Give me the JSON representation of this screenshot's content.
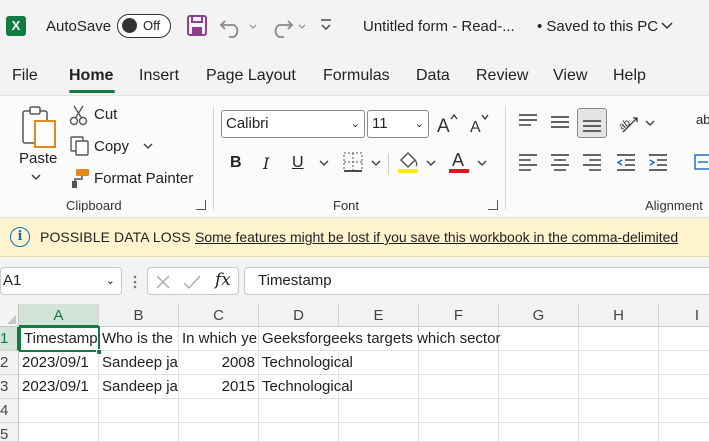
{
  "titlebar": {
    "app_letter": "X",
    "autosave_label": "AutoSave",
    "autosave_state": "Off",
    "title": "Untitled form  -  Read-...",
    "save_status": "• Saved to this PC"
  },
  "tabs": [
    "File",
    "Home",
    "Insert",
    "Page Layout",
    "Formulas",
    "Data",
    "Review",
    "View",
    "Help"
  ],
  "active_tab": "Home",
  "ribbon": {
    "clipboard": {
      "paste": "Paste",
      "cut": "Cut",
      "copy": "Copy",
      "format_painter": "Format Painter",
      "group_label": "Clipboard"
    },
    "font": {
      "font_name": "Calibri",
      "font_size": "11",
      "bold": "B",
      "italic": "I",
      "underline": "U",
      "group_label": "Font"
    },
    "alignment": {
      "group_label": "Alignment",
      "wrap_partial": "ab"
    }
  },
  "message_bar": {
    "title": "POSSIBLE DATA LOSS",
    "text": "Some features might be lost if you save this workbook in the comma-delimited"
  },
  "formula_bar": {
    "name_box": "A1",
    "fx": "fx",
    "value": "Timestamp"
  },
  "grid": {
    "columns": [
      "A",
      "B",
      "C",
      "D",
      "E",
      "F",
      "G",
      "H",
      "I"
    ],
    "rows": [
      "1",
      "2",
      "3",
      "4",
      "5"
    ],
    "cells": [
      [
        "Timestamp",
        "Who is the",
        "In which ye",
        "Geeksforgeeks targets which sector"
      ],
      [
        "2023/09/1",
        "Sandeep ja",
        "2008",
        "Technological"
      ],
      [
        "2023/09/1",
        "Sandeep ja",
        "2015",
        "Technological"
      ]
    ]
  },
  "colors": {
    "excel_green": "#107c41",
    "message_bar_bg": "#fff4ce",
    "info_blue": "#0f6cbd",
    "highlight_yellow": "#ffeb00",
    "font_red": "#e81123"
  }
}
